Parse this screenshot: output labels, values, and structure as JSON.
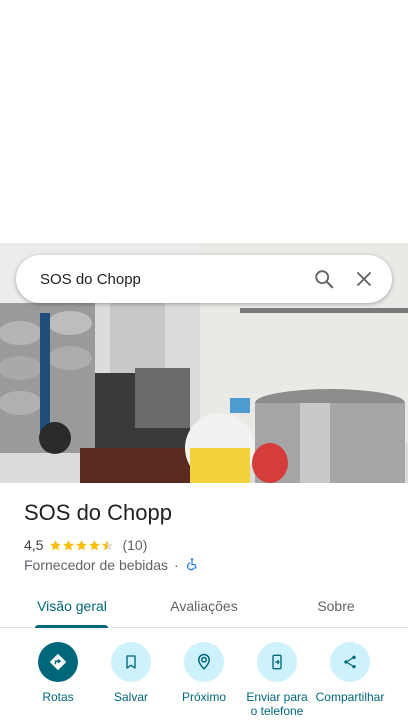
{
  "search": {
    "query": "SOS do Chopp"
  },
  "place": {
    "name": "SOS do Chopp",
    "rating": "4,5",
    "stars": 4.5,
    "review_count": "(10)",
    "category": "Fornecedor de bebidas",
    "separator": "·"
  },
  "tabs": [
    {
      "label": "Visão geral",
      "active": true
    },
    {
      "label": "Avaliações",
      "active": false
    },
    {
      "label": "Sobre",
      "active": false
    }
  ],
  "actions": [
    {
      "label": "Rotas",
      "icon": "directions-icon"
    },
    {
      "label": "Salvar",
      "icon": "bookmark-icon"
    },
    {
      "label": "Próximo",
      "icon": "nearby-icon"
    },
    {
      "label": "Enviar para o telefone",
      "icon": "send-to-phone-icon"
    },
    {
      "label": "Compartilhar",
      "icon": "share-icon"
    }
  ],
  "colors": {
    "accent": "#00677a",
    "action_bg": "#cdf2fb",
    "star": "#fbbc04"
  }
}
